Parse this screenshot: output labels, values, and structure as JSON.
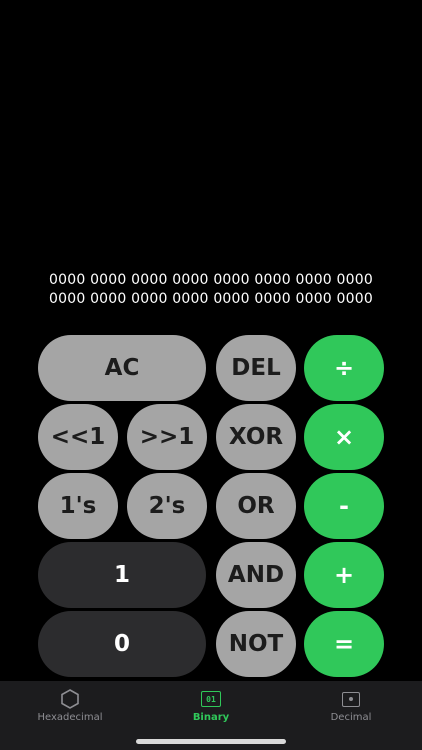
{
  "display": {
    "line1": "0000 0000 0000 0000 0000 0000 0000 0000",
    "line2": "0000 0000 0000 0000 0000 0000 0000 0000"
  },
  "keys": {
    "ac": "AC",
    "del": "DEL",
    "divide": "÷",
    "shift_left": "<<1",
    "shift_right": ">>1",
    "xor": "XOR",
    "multiply": "×",
    "ones_complement": "1's",
    "twos_complement": "2's",
    "or": "OR",
    "minus": "-",
    "one": "1",
    "and": "AND",
    "plus": "+",
    "zero": "0",
    "not": "NOT",
    "equals": "="
  },
  "tabs": [
    {
      "label": "Hexadecimal",
      "icon": "hexagon-icon",
      "active": false
    },
    {
      "label": "Binary",
      "icon": "binary-icon",
      "icon_text": "01",
      "active": true
    },
    {
      "label": "Decimal",
      "icon": "decimal-icon",
      "active": false
    }
  ],
  "colors": {
    "background": "#000000",
    "gray_key": "#a5a5a5",
    "dark_key": "#2c2c2e",
    "accent": "#30c85a",
    "tabbar": "#1c1c1e",
    "inactive_tab": "#8e8e93"
  }
}
